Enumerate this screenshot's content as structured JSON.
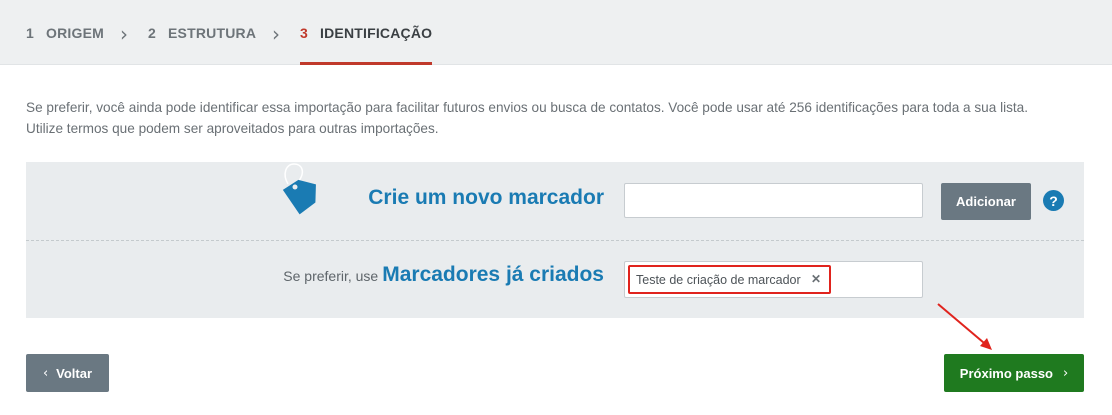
{
  "wizard": {
    "steps": [
      {
        "number": "1",
        "label": "ORIGEM"
      },
      {
        "number": "2",
        "label": "ESTRUTURA"
      },
      {
        "number": "3",
        "label": "IDENTIFICAÇÃO"
      }
    ],
    "active_step": 3,
    "separator": "›"
  },
  "description": {
    "line1": "Se preferir, você ainda pode identificar essa importação para facilitar futuros envios ou busca de contatos. Você pode usar até 256 identificações para toda a sua lista.",
    "line2": "Utilize termos que podem ser aproveitados para outras importações."
  },
  "new_tag": {
    "title": "Crie um novo marcador",
    "input_value": "",
    "add_label": "Adicionar",
    "help_symbol": "?",
    "icon": "tag-icon"
  },
  "existing_tags": {
    "prefix": "Se preferir, use",
    "title": "Marcadores já criados",
    "selected": [
      {
        "label": "Teste de criação de marcador",
        "remove_symbol": "✕"
      }
    ]
  },
  "footer": {
    "back_label": "Voltar",
    "back_icon": "‹",
    "next_label": "Próximo passo",
    "next_icon": "›"
  },
  "colors": {
    "accent_blue": "#1a7bb3",
    "active_step": "#c0392b",
    "next_button": "#1f7a1f",
    "highlight_box": "#e0231d"
  }
}
